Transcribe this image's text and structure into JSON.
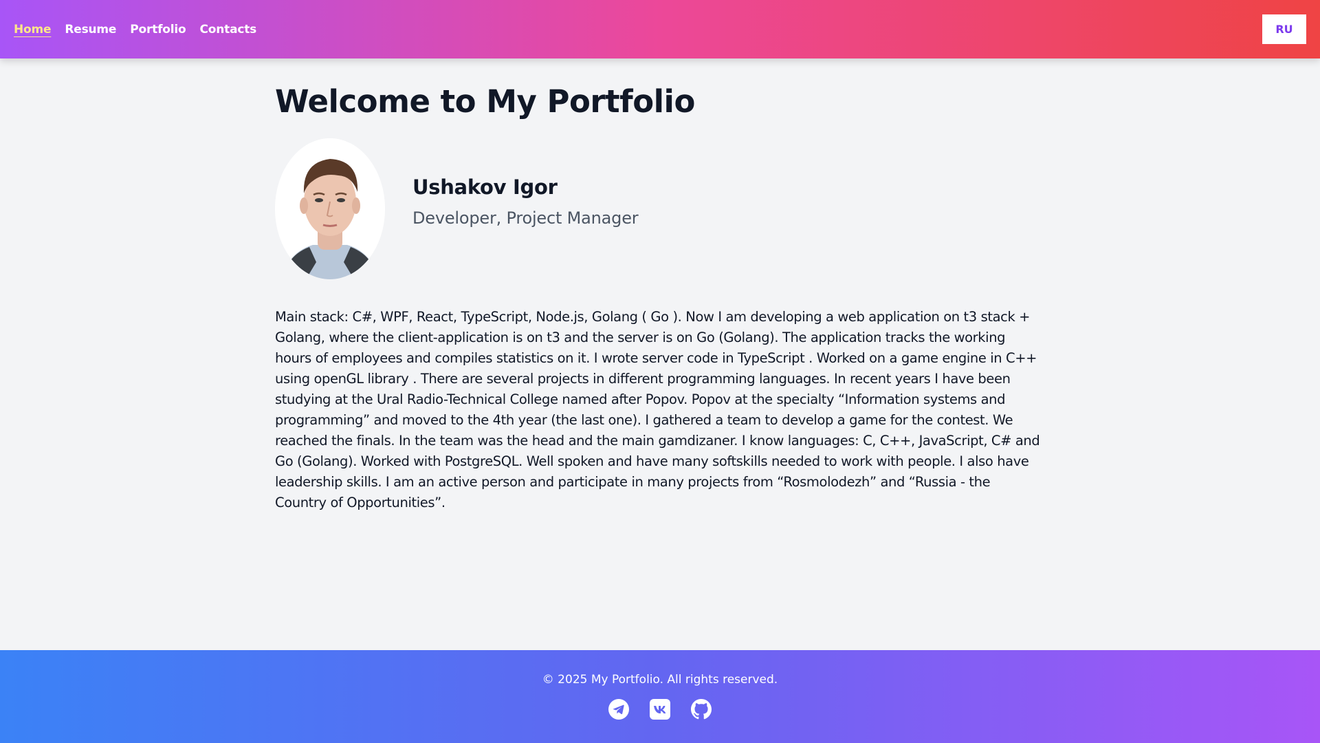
{
  "nav": {
    "items": [
      {
        "label": "Home",
        "active": true
      },
      {
        "label": "Resume",
        "active": false
      },
      {
        "label": "Portfolio",
        "active": false
      },
      {
        "label": "Contacts",
        "active": false
      }
    ],
    "language_button": "RU"
  },
  "main": {
    "title": "Welcome to My Portfolio",
    "name": "Ushakov Igor",
    "role": "Developer, Project Manager",
    "bio": "Main stack: C#, WPF, React, TypeScript, Node.js, Golang ( Go ). Now I am developing a web application on t3 stack + Golang, where the client-application is on t3 and the server is on Go (Golang). The application tracks the working hours of employees and compiles statistics on it. I wrote server code in TypeScript . Worked on a game engine in C++ using openGL library . There are several projects in different programming languages. In recent years I have been studying at the Ural Radio-Technical College named after Popov. Popov at the specialty “Information systems and programming” and moved to the 4th year (the last one). I gathered a team to develop a game for the contest. We reached the finals. In the team was the head and the main gamdizaner. I know languages: C, C++, JavaScript, C# and Go (Golang). Worked with PostgreSQL. Well spoken and have many softskills needed to work with people. I also have leadership skills. I am an active person and participate in many projects from “Rosmolodezh” and “Russia - the Country of Opportunities”."
  },
  "footer": {
    "copyright": "© 2025 My Portfolio. All rights reserved.",
    "socials": [
      "telegram-icon",
      "vk-icon",
      "github-icon"
    ]
  },
  "colors": {
    "header_gradient": [
      "#a855f7",
      "#ec4899",
      "#ef4444"
    ],
    "footer_gradient": [
      "#3b82f6",
      "#6366f1",
      "#a855f7"
    ],
    "active_nav": "#fde68a",
    "lang_button_text": "#7c3aed",
    "background": "#f3f4f6"
  }
}
